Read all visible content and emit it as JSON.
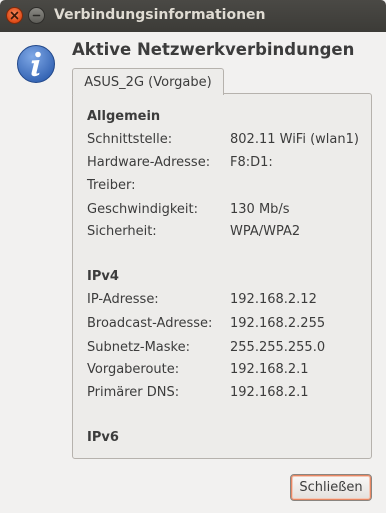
{
  "window": {
    "title": "Verbindungsinformationen"
  },
  "header": {
    "title": "Aktive Netzwerkverbindungen",
    "icon": "info-icon"
  },
  "tabs": [
    {
      "label": "ASUS_2G (Vorgabe)",
      "selected": true
    }
  ],
  "general": {
    "heading": "Allgemein",
    "rows": [
      {
        "label": "Schnittstelle:",
        "value": "802.11 WiFi (wlan1)"
      },
      {
        "label": "Hardware-Adresse:",
        "value": "F8:D1:"
      },
      {
        "label": "Treiber:",
        "value": ""
      },
      {
        "label": "Geschwindigkeit:",
        "value": "130 Mb/s"
      },
      {
        "label": "Sicherheit:",
        "value": "WPA/WPA2"
      }
    ]
  },
  "ipv4": {
    "heading": "IPv4",
    "rows": [
      {
        "label": "IP-Adresse:",
        "value": "192.168.2.12"
      },
      {
        "label": "Broadcast-Adresse:",
        "value": "192.168.2.255"
      },
      {
        "label": "Subnetz-Maske:",
        "value": "255.255.255.0"
      },
      {
        "label": "Vorgaberoute:",
        "value": "192.168.2.1"
      },
      {
        "label": "Primärer DNS:",
        "value": "192.168.2.1"
      }
    ]
  },
  "ipv6": {
    "heading": "IPv6"
  },
  "footer": {
    "close_label": "Schließen"
  },
  "colors": {
    "titlebar": "#3c3b37",
    "close_button": "#df4a16",
    "info_icon": "#3a6fc4",
    "text": "#3c3c3c"
  }
}
